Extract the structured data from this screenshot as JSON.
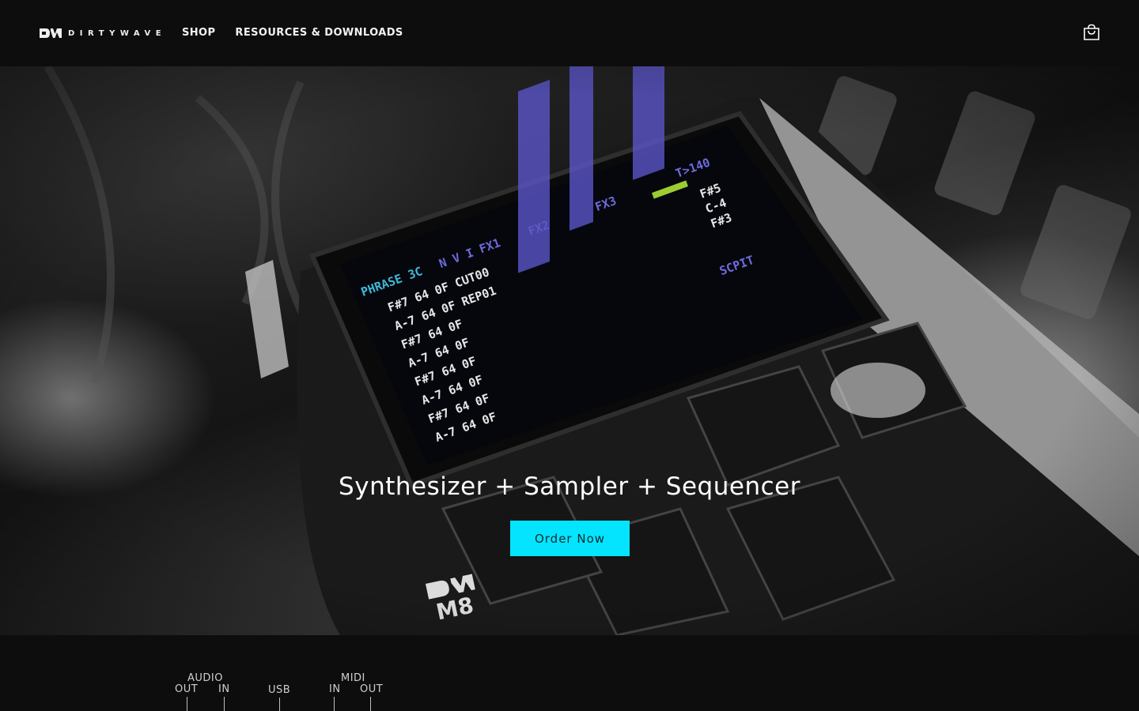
{
  "brand": {
    "name": "DIRTYWAVE"
  },
  "nav": {
    "items": [
      {
        "label": "SHOP"
      },
      {
        "label": "RESOURCES & DOWNLOADS"
      }
    ]
  },
  "header": {
    "cart_icon": "shopping-bag-icon"
  },
  "hero": {
    "title": "Synthesizer + Sampler + Sequencer",
    "cta_label": "Order Now",
    "cta_color": "#05e4ff",
    "image_description_icon": "m8-device-photo",
    "device_logo": "M8"
  },
  "ports": {
    "audio": {
      "label": "AUDIO",
      "out": "OUT",
      "in": "IN"
    },
    "usb": {
      "label": "USB"
    },
    "midi": {
      "label": "MIDI",
      "in": "IN",
      "out": "OUT"
    }
  }
}
